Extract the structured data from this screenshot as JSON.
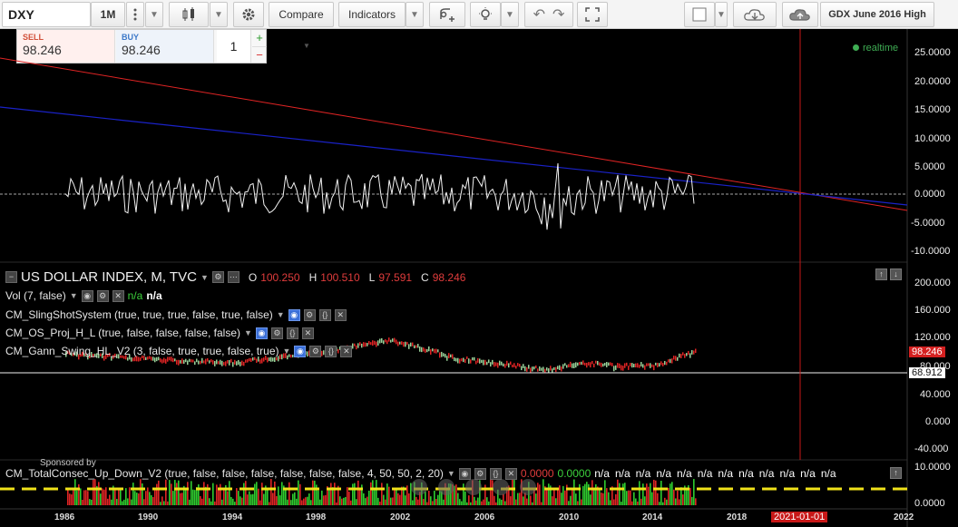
{
  "toolbar": {
    "symbol": "DXY",
    "interval": "1M",
    "compare_label": "Compare",
    "indicators_label": "Indicators",
    "saved_layout": "GDX June 2016 High"
  },
  "trade": {
    "sell_label": "SELL",
    "sell_value": "98.246",
    "buy_label": "BUY",
    "buy_value": "98.246",
    "quantity": "1",
    "plus": "+",
    "minus": "−"
  },
  "status": {
    "realtime": "realtime"
  },
  "top_pane": {
    "y_ticks": [
      "25.0000",
      "20.0000",
      "15.0000",
      "10.0000",
      "5.0000",
      "0.0000",
      "-5.0000",
      "-10.0000"
    ]
  },
  "main_pane": {
    "title": "US DOLLAR INDEX, M, TVC",
    "o_label": "O",
    "o_value": "100.250",
    "h_label": "H",
    "h_value": "100.510",
    "l_label": "L",
    "l_value": "97.591",
    "c_label": "C",
    "c_value": "98.246",
    "y_ticks": [
      "200.000",
      "160.000",
      "120.000",
      "80.000",
      "40.000",
      "0.000",
      "-40.000"
    ],
    "price_tag": "98.246",
    "line_tag": "68.912",
    "indicators": [
      {
        "name": "Vol (7, false)",
        "v1": "n/a",
        "v2": "n/a"
      },
      {
        "name": "CM_SlingShotSystem (true, true, true, false, true, false)"
      },
      {
        "name": "CM_OS_Proj_H_L (true, false, false, false, false)"
      },
      {
        "name": "CM_Gann_Swing_HL_V2 (3, false, true, true, false, true)"
      }
    ]
  },
  "bottom_pane": {
    "indicator": "CM_TotalConsec_Up_Down_V2 (true, false, false, false, false, false, false, 4, 50, 50, 2, 20)",
    "val1": "0.0000",
    "val2": "0.0000",
    "na_values": [
      "n/a",
      "n/a",
      "n/a",
      "n/a",
      "n/a",
      "n/a",
      "n/a",
      "n/a",
      "n/a",
      "n/a",
      "n/a",
      "n/a"
    ],
    "y_ticks": [
      "10.0000",
      "0.0000"
    ],
    "sponsor": "Sponsored by"
  },
  "x_axis": {
    "years": [
      "1986",
      "1990",
      "1994",
      "1998",
      "2002",
      "2006",
      "2010",
      "2014",
      "2018",
      "2022"
    ],
    "cursor_date": "2021-01-01"
  },
  "colors": {
    "trend_red": "#e02424",
    "trend_blue": "#1a22c8",
    "oscillator": "#f2f2f2",
    "up_bar": "#2ecc2e",
    "down_bar": "#e02424",
    "cursor": "#c81818",
    "dash_yellow": "#f0e21a"
  }
}
